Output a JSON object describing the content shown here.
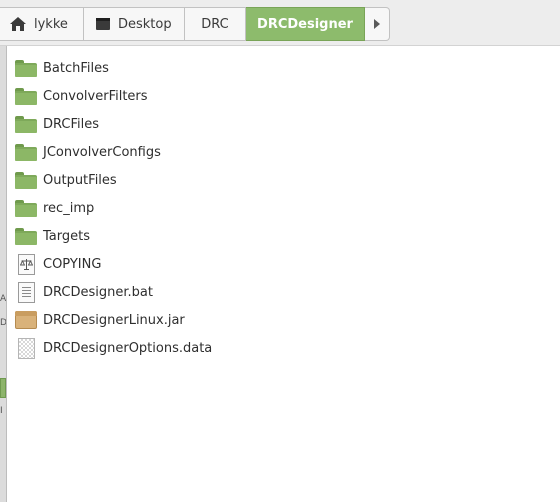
{
  "breadcrumb": {
    "items": [
      {
        "label": "lykke",
        "icon": "home-icon"
      },
      {
        "label": "Desktop",
        "icon": "desktop-icon"
      },
      {
        "label": "DRC",
        "icon": ""
      },
      {
        "label": "DRCDesigner",
        "icon": "",
        "active": true
      }
    ],
    "next_icon": "chevron-right-icon"
  },
  "left_strip": {
    "marks": [
      "A",
      "D",
      "I"
    ]
  },
  "files": [
    {
      "name": "BatchFiles",
      "type": "folder"
    },
    {
      "name": "ConvolverFilters",
      "type": "folder"
    },
    {
      "name": "DRCFiles",
      "type": "folder"
    },
    {
      "name": "JConvolverConfigs",
      "type": "folder"
    },
    {
      "name": "OutputFiles",
      "type": "folder"
    },
    {
      "name": "rec_imp",
      "type": "folder"
    },
    {
      "name": "Targets",
      "type": "folder"
    },
    {
      "name": "COPYING",
      "type": "license-file"
    },
    {
      "name": "DRCDesigner.bat",
      "type": "text-file"
    },
    {
      "name": "DRCDesignerLinux.jar",
      "type": "archive-file"
    },
    {
      "name": "DRCDesignerOptions.data",
      "type": "binary-file"
    }
  ],
  "colors": {
    "accent": "#8dbb6c",
    "folder": "#7ea95a",
    "toolbar": "#ededed"
  }
}
